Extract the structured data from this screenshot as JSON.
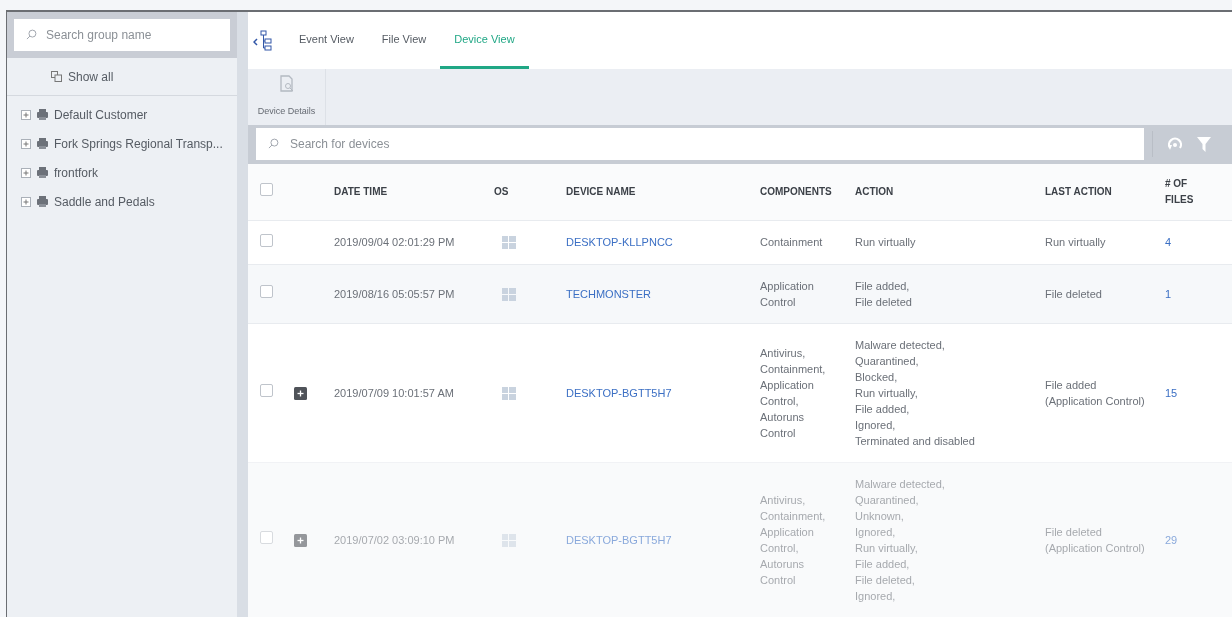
{
  "sidebar": {
    "search": {
      "placeholder": "Search group name"
    },
    "show_all": "Show all",
    "groups": [
      {
        "label": "Default Customer",
        "expanded": false
      },
      {
        "label": "Fork Springs Regional Transp...",
        "expanded": false
      },
      {
        "label": "frontfork",
        "expanded": false
      },
      {
        "label": "Saddle and Pedals",
        "expanded": false
      }
    ]
  },
  "tabs": [
    {
      "label": "Event View",
      "selected": false
    },
    {
      "label": "File View",
      "selected": false
    },
    {
      "label": "Device View",
      "selected": true
    }
  ],
  "toolbar": {
    "device_details": "Device Details"
  },
  "device_search": {
    "placeholder": "Search for devices"
  },
  "table": {
    "select_all_checked": false,
    "columns": [
      "DATE TIME",
      "OS",
      "DEVICE NAME",
      "COMPONENTS",
      "ACTION",
      "LAST ACTION",
      "# OF FILES"
    ],
    "rows": [
      {
        "checked": false,
        "expandable": false,
        "date_time": "2019/09/04 02:01:29 PM",
        "device_name": "DESKTOP-KLLPNCC",
        "components": [
          "Containment"
        ],
        "action": [
          "Run virtually"
        ],
        "last_action": [
          "Run virtually"
        ],
        "files": "4"
      },
      {
        "checked": false,
        "expandable": false,
        "date_time": "2019/08/16 05:05:57 PM",
        "device_name": "TECHMONSTER",
        "components": [
          "Application",
          "Control"
        ],
        "action": [
          "File added,",
          "File deleted"
        ],
        "last_action": [
          "File deleted"
        ],
        "files": "1"
      },
      {
        "checked": false,
        "expandable": true,
        "date_time": "2019/07/09 10:01:57 AM",
        "device_name": "DESKTOP-BGTT5H7",
        "components": [
          "Antivirus,",
          "Containment,",
          "Application",
          "Control,",
          "Autoruns",
          "Control"
        ],
        "action": [
          "Malware detected,",
          "Quarantined,",
          "Blocked,",
          "Run virtually,",
          "File added,",
          "Ignored,",
          "Terminated and disabled"
        ],
        "last_action": [
          "File added",
          "(Application Control)"
        ],
        "files": "15"
      },
      {
        "checked": false,
        "expandable": true,
        "date_time": "2019/07/02 03:09:10 PM",
        "device_name": "DESKTOP-BGTT5H7",
        "components": [
          "Antivirus,",
          "Containment,",
          "Application",
          "Control,",
          "Autoruns",
          "Control"
        ],
        "action": [
          "Malware detected,",
          "Quarantined,",
          "Unknown,",
          "Ignored,",
          "Run virtually,",
          "File added,",
          "File deleted,",
          "Ignored,"
        ],
        "last_action": [
          "File deleted",
          "(Application Control)"
        ],
        "files": "29"
      }
    ]
  }
}
